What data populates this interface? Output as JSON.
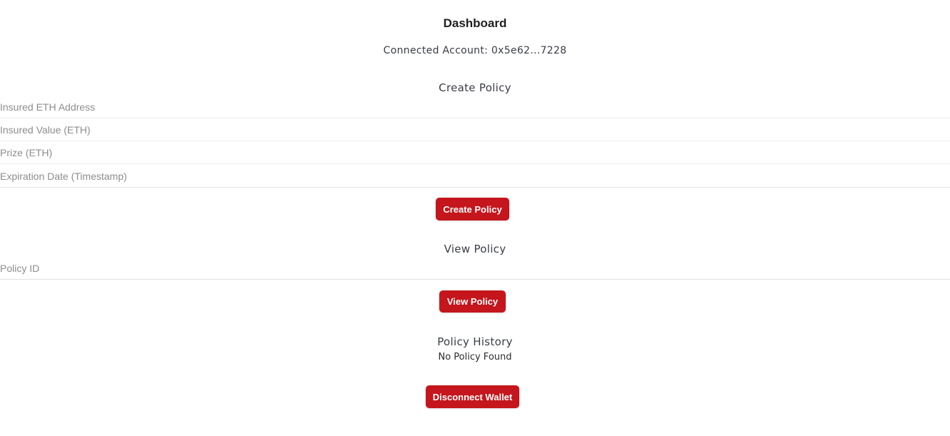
{
  "header": {
    "title": "Dashboard",
    "connected_account": "Connected Account: 0x5e62...7228"
  },
  "create_policy": {
    "heading": "Create Policy",
    "fields": [
      {
        "placeholder": "Insured ETH Address",
        "value": ""
      },
      {
        "placeholder": "Insured Value (ETH)",
        "value": ""
      },
      {
        "placeholder": "Prize (ETH)",
        "value": ""
      },
      {
        "placeholder": "Expiration Date (Timestamp)",
        "value": ""
      }
    ],
    "button_label": "Create Policy"
  },
  "view_policy": {
    "heading": "View Policy",
    "field": {
      "placeholder": "Policy ID",
      "value": ""
    },
    "button_label": "View Policy"
  },
  "policy_history": {
    "heading": "Policy History",
    "empty_text": "No Policy Found"
  },
  "wallet": {
    "disconnect_label": "Disconnect Wallet"
  },
  "colors": {
    "accent": "#c4161c",
    "heading_text": "#3a3d48",
    "placeholder": "#8d8d8d"
  }
}
